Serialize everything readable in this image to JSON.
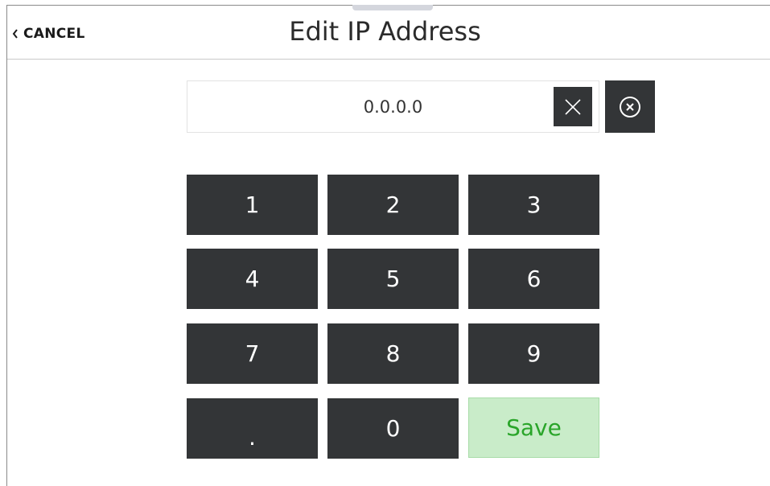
{
  "header": {
    "cancel_label": "CANCEL",
    "title": "Edit IP Address"
  },
  "ip_field": {
    "value": "0.0.0.0"
  },
  "icons": {
    "cancel": "chevron-left-icon",
    "clear": "close-icon",
    "backspace": "backspace-circle-x-icon"
  },
  "keypad": {
    "keys": [
      "1",
      "2",
      "3",
      "4",
      "5",
      "6",
      "7",
      "8",
      "9",
      ".",
      "0"
    ],
    "save_label": "Save"
  },
  "colors": {
    "key_background": "#333537",
    "save_background": "#c9ecc9",
    "save_text": "#2aa52a"
  }
}
